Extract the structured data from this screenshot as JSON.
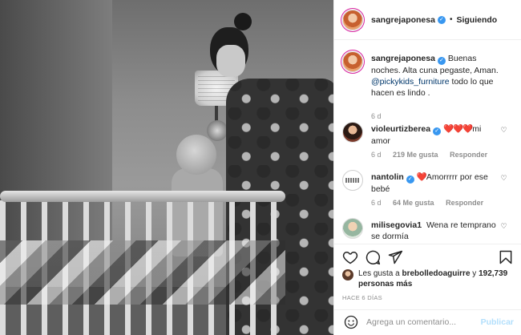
{
  "post": {
    "author": "sangrejaponesa",
    "follow_label": "Siguiendo",
    "separator": "•"
  },
  "caption": {
    "user": "sangrejaponesa",
    "text_before": "Buenas noches. Alta cuna pegaste, Aman.",
    "mention": "@pickykids_furniture",
    "text_after": "todo lo que hacen es lindo .",
    "time": "6 d"
  },
  "comments": [
    {
      "user": "violeurtizberea",
      "hearts": "❤️❤️❤️",
      "text": "mi amor",
      "time": "6 d",
      "likes": "219 Me gusta",
      "reply": "Responder"
    },
    {
      "user": "nantolin",
      "hearts": "❤️",
      "text": "Amorrrrr por ese bebé",
      "time": "6 d",
      "likes": "64 Me gusta",
      "reply": "Responder"
    },
    {
      "user": "milisegovia1",
      "hearts": "",
      "text": "Wena re temprano se dormía",
      "time": "",
      "likes": "",
      "reply": ""
    }
  ],
  "likes": {
    "prefix": "Les gusta a",
    "user": "brebolledoaguirre",
    "conj": "y",
    "count": "192,739 personas más"
  },
  "timestamp": "HACE 6 DÍAS",
  "comment_box": {
    "placeholder": "Agrega un comentario...",
    "publish": "Publicar"
  },
  "colors": {
    "verified": "#3897f0",
    "heart": "#ed4956",
    "publish_disabled": "#b2dffc",
    "muted": "#8e8e8e",
    "mention": "#00376b"
  },
  "icons": [
    "verified-icon",
    "heart-icon",
    "comment-icon",
    "share-icon",
    "bookmark-icon",
    "emoji-icon"
  ]
}
